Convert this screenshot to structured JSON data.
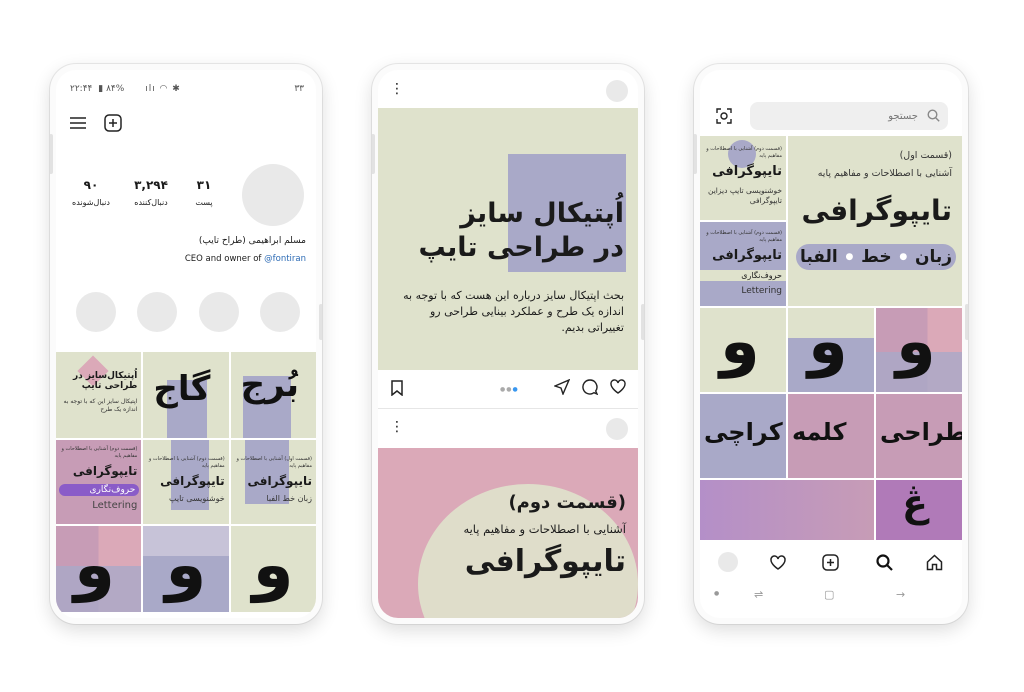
{
  "colors": {
    "sage": "#dfe2cc",
    "lavender": "#a9a9c8",
    "mauve": "#c79cb6",
    "pink": "#dba9b8",
    "accent": "#8a5cc8",
    "link": "#2d6bb5"
  },
  "profile": {
    "status_time": "۲۲:۴۴",
    "status_battery": "۸۴%",
    "status_right": "۳۳",
    "stats": [
      {
        "value": "۹۰",
        "label": "دنبال‌شونده"
      },
      {
        "value": "۳,۲۹۴",
        "label": "دنبال‌کننده"
      },
      {
        "value": "۳۱",
        "label": "پست"
      }
    ],
    "name": "مسلم ابراهیمی (طراح تایپ)",
    "bio_prefix": "CEO and owner of",
    "bio_handle": "@fontiran",
    "tiles": {
      "t1_title": "اُپتیکال‌سایز در طراحی تایپ",
      "t1_body": "اپتیکال سایز این که با توجه به اندازه یک طرح",
      "t2_glyph": "گاج",
      "t3_glyph": "بُرج",
      "t4_small": "(قسمت دوم) آشنایی با اصطلاحات و مفاهیم پایه",
      "t4_title": "تایپوگرافی",
      "t4_pill": "حروف‌نگاری",
      "t4_latin": "Lettering",
      "t5_small": "(قسمت دوم) آشنایی با اصطلاحات و مفاهیم پایه",
      "t5_title": "تایپوگرافی",
      "t5_sub": "خوشنویسی تایپ",
      "t6_small": "(قسمت اول) آشنایی با اصطلاحات و مفاهیم پایه",
      "t6_title": "تایپوگرافی",
      "t6_sub": "زبان خط الفبا",
      "waw": "و"
    }
  },
  "post": {
    "headline_line1": "اُپتیکال سایز",
    "headline_line2": "در طراحی تایپ",
    "caption": "بحث اپتیکال سایز درباره این هست که با توجه به اندازه یک طرح و عملکرد بینایی طراحی رو تغییراتی بدیم.",
    "second_part": "(قسمت دوم)",
    "second_sub": "آشنایی با اصطلاحات و مفاهیم پایه",
    "second_title": "تایپوگرافی"
  },
  "explore": {
    "search_placeholder": "جستجو",
    "big_small": "(قسمت اول)",
    "big_sub": "آشنایی با اصطلاحات و مفاهیم پایه",
    "big_title": "تایپوگرافی",
    "big_words": [
      "زبان",
      "خط",
      "الفبا"
    ],
    "t1_small": "(قسمت دوم) آشنایی با اصطلاحات و مفاهیم پایه",
    "t1_title": "تایپوگرافی",
    "t1_sub": "خوشنویسی تایپ دیزاین تایپوگرافی",
    "t2_small": "(قسمت دوم) آشنایی با اصطلاحات و مفاهیم پایه",
    "t2_title": "تایپوگرافی",
    "t2_sub": "حروف‌نگاری",
    "t2_latin": "Lettering",
    "waw": "و",
    "word1": "طراحی",
    "word2": "کلمه",
    "word3": "کراچی",
    "glyph_last": "ڠ"
  },
  "icons": [
    "menu-icon",
    "add-icon",
    "heart-icon",
    "comment-icon",
    "send-icon",
    "bookmark-icon",
    "search-icon",
    "home-icon",
    "scan-icon",
    "more-icon"
  ]
}
